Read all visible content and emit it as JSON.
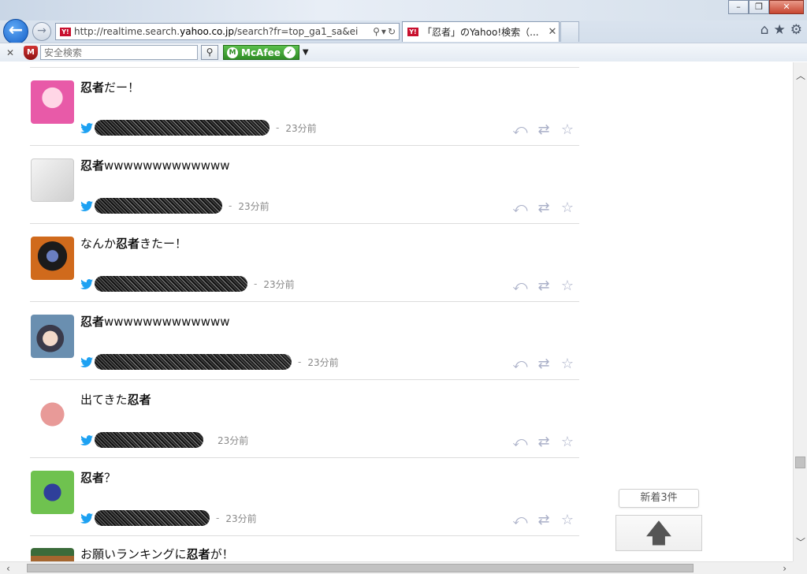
{
  "browser": {
    "url_prefix": "http://realtime.search.",
    "url_domain": "yahoo.co.jp",
    "url_suffix": "/search?fr=top_ga1_sa&ei",
    "favicon": "Y!",
    "tab_title": "「忍者」のYahoo!検索（...",
    "safe_search_placeholder": "安全検索",
    "mcafee_label": "McAfee",
    "icons": [
      "back-arrow-icon",
      "forward-arrow-icon",
      "search-icon",
      "refresh-icon",
      "home-icon",
      "star-icon",
      "gear-icon"
    ]
  },
  "tweets": [
    {
      "pre": "",
      "kw": "忍者",
      "post": "だー！",
      "time": "23分前",
      "avatar_color": "#e85aa8"
    },
    {
      "pre": "",
      "kw": "忍者",
      "post": "wwwwwwwwwwwww",
      "time": "23分前",
      "avatar_color": "#d8d8d8"
    },
    {
      "pre": "なんか",
      "kw": "忍者",
      "post": "きたー！",
      "time": "23分前",
      "avatar_color": "#d06a1c"
    },
    {
      "pre": "",
      "kw": "忍者",
      "post": "wwwwwwwwwwwww",
      "time": "23分前",
      "avatar_color": "#6a8fb0"
    },
    {
      "pre": "出てきた",
      "kw": "忍者",
      "post": "",
      "time": "23分前",
      "avatar_color": "#e89a98"
    },
    {
      "pre": "",
      "kw": "忍者",
      "post": "？",
      "time": "23分前",
      "avatar_color": "#6fc24f"
    }
  ],
  "partial_tweet": {
    "pre": "お願いランキングに",
    "kw": "忍者",
    "post": "が！",
    "avatar_color": "#a5662f"
  },
  "new_tweets": {
    "label": "新着3件"
  },
  "colors": {
    "twitter_blue": "#1da1f2",
    "action_gray": "#aab0c8"
  }
}
